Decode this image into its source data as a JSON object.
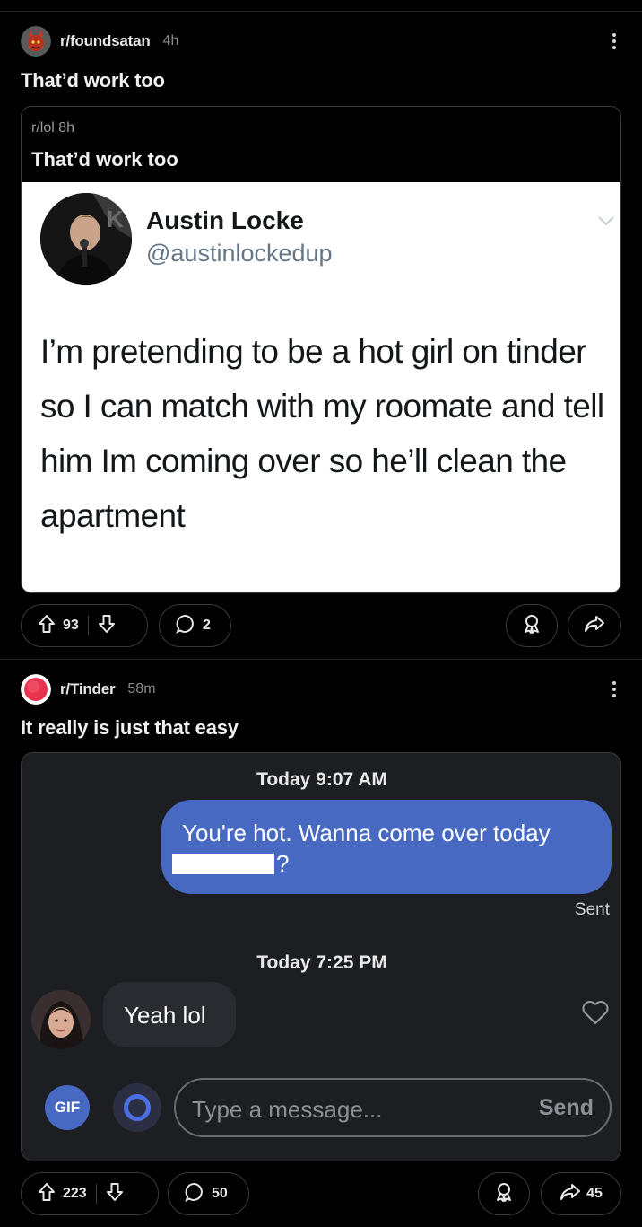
{
  "post1": {
    "subreddit": "r/foundsatan",
    "age": "4h",
    "title": "That’d work too",
    "crosspost": {
      "subreddit_age": "r/lol 8h",
      "title": "That’d work too",
      "tweet": {
        "name": "Austin Locke",
        "handle": "@austinlockedup",
        "text": "I’m pretending to be a hot girl on tinder so I can match with my roomate and tell him Im coming over so he’ll clean the apartment"
      }
    },
    "actions": {
      "upvotes": "93",
      "comments": "2"
    }
  },
  "post2": {
    "subreddit": "r/Tinder",
    "age": "58m",
    "title": "It really is just that easy",
    "chat": {
      "timestamp1": "Today 9:07 AM",
      "outgoing_line1": "You're hot. Wanna come over today",
      "outgoing_end": "?",
      "sent_label": "Sent",
      "timestamp2": "Today 7:25 PM",
      "incoming": "Yeah lol",
      "gif_label": "GIF",
      "input_placeholder": "Type a message...",
      "send_label": "Send"
    },
    "actions": {
      "upvotes": "223",
      "comments": "50",
      "shares": "45"
    }
  },
  "icons": [
    "upvote-icon",
    "downvote-icon",
    "comment-icon",
    "award-icon",
    "share-icon",
    "heart-icon",
    "chevron-down-icon",
    "more-icon"
  ]
}
